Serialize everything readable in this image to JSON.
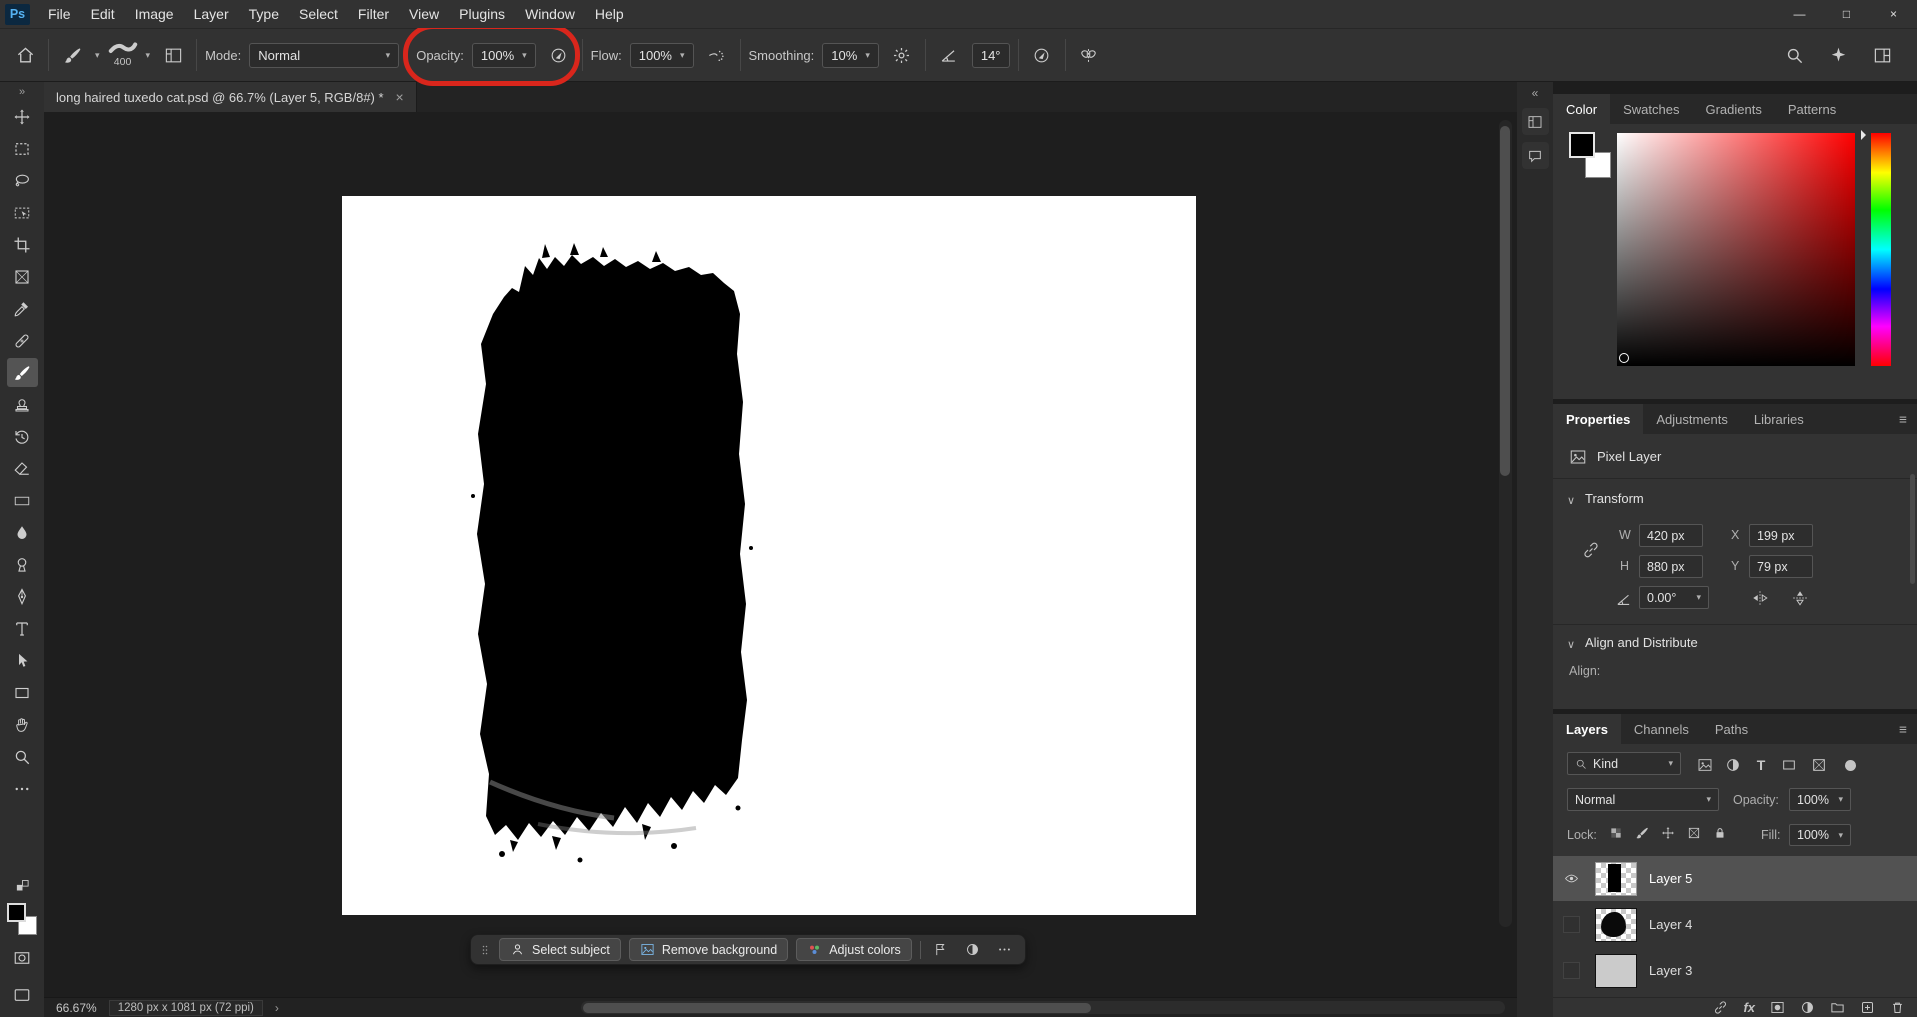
{
  "colors": {
    "annotation_red": "#d9261c",
    "foreground_swatch": "#000000",
    "background_swatch": "#ffffff",
    "selected_layer_highlight": "#525252"
  },
  "glyphs": {
    "dropdown": "▾",
    "section_chevron": "∨",
    "toolbar_expand": "»",
    "dock_collapse": "«",
    "panel_menu": "≡"
  },
  "menubar": {
    "logo": "Ps",
    "items": [
      "File",
      "Edit",
      "Image",
      "Layer",
      "Type",
      "Select",
      "Filter",
      "View",
      "Plugins",
      "Window",
      "Help"
    ],
    "minimize": "—",
    "maximize": "□",
    "close": "×"
  },
  "options_bar": {
    "brush_size": "400",
    "mode_label": "Mode:",
    "mode_value": "Normal",
    "opacity_label": "Opacity:",
    "opacity_value": "100%",
    "flow_label": "Flow:",
    "flow_value": "100%",
    "smoothing_label": "Smoothing:",
    "smoothing_value": "10%",
    "angle_value": "14°"
  },
  "document_tab": {
    "title": "long haired tuxedo cat.psd @ 66.7% (Layer 5, RGB/8#) *",
    "close": "×"
  },
  "contextual_taskbar": {
    "select_subject": "Select subject",
    "remove_background": "Remove background",
    "adjust_colors": "Adjust colors"
  },
  "panels": {
    "color": {
      "tabs": [
        "Color",
        "Swatches",
        "Gradients",
        "Patterns"
      ]
    },
    "properties": {
      "tabs": [
        "Properties",
        "Adjustments",
        "Libraries"
      ],
      "layer_type": "Pixel Layer",
      "transform_title": "Transform",
      "w_label": "W",
      "w_value": "420 px",
      "x_label": "X",
      "x_value": "199 px",
      "h_label": "H",
      "h_value": "880 px",
      "y_label": "Y",
      "y_value": "79 px",
      "angle_value": "0.00°",
      "align_title": "Align and Distribute",
      "align_label": "Align:"
    },
    "layers": {
      "tabs": [
        "Layers",
        "Channels",
        "Paths"
      ],
      "kind_label": "Kind",
      "blend_mode": "Normal",
      "opacity_label": "Opacity:",
      "opacity_value": "100%",
      "lock_label": "Lock:",
      "fill_label": "Fill:",
      "fill_value": "100%",
      "type_filter_label": "T",
      "fx_label": "fx",
      "layers": [
        {
          "name": "Layer 5",
          "selected": true,
          "visible": true
        },
        {
          "name": "Layer 4",
          "selected": false,
          "visible": false
        },
        {
          "name": "Layer 3",
          "selected": false,
          "visible": false
        }
      ]
    }
  },
  "status_bar": {
    "zoom": "66.67%",
    "doc_info": "1280 px x 1081 px (72 ppi)",
    "chevron": "›"
  }
}
